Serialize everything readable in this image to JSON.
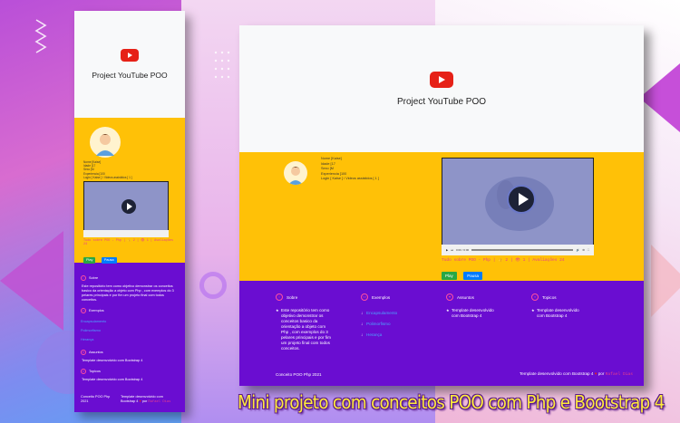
{
  "colors": {
    "primary_purple": "#6a0dd1",
    "yellow": "#ffc107",
    "light": "#f8f9fa",
    "youtube_red": "#e62117",
    "pink_text": "#e83e8c",
    "caption_yellow": "#ffeb3b",
    "play_button": "#28a745",
    "pause_button": "#007bff",
    "link_blue": "#4da3ff"
  },
  "app": {
    "title": "Project YouTube POO",
    "logo_icon": "youtube-play-icon"
  },
  "profile": {
    "nome": "Nome [Kaise]",
    "idade": "Idade [17",
    "sexo": "Sexo [M",
    "experiencia": "Experiencia [100",
    "login_line": "Login [ Kaise ] / Videos assistidos [ 1 ]"
  },
  "video": {
    "time": "0:00 / 0:00",
    "stats": "Tudo sobre POO - Php | 👍 2 | 👁 1 | Avaliações 24",
    "play_label": "Play",
    "pause_label": "Pausa"
  },
  "sections": {
    "sobre": {
      "heading": "Sobre",
      "text": "Este repositório tem como objetivo demonstrar os conceitos basico da orientação a objeto com Php , com exemplos do 3 pelares principais e por fim um projeto final com todos conceitos."
    },
    "exemplos": {
      "heading": "Exemplos",
      "links": [
        "Encapsulamento",
        "Polimorfismo",
        "Herança"
      ]
    },
    "assuntos": {
      "heading": "Assuntos",
      "text": "Template desenvolvido com Bootstrap 4"
    },
    "topicos": {
      "heading": "Topicos",
      "text": "Template desenvolvido com Bootstrap 4"
    }
  },
  "footer": {
    "left": "Conceito POO Php 2021",
    "right_prefix": "Template desenvolvido com Bootstrap 4",
    "right_por": "por",
    "author": "Rafael Dias"
  },
  "caption": "Mini projeto com conceitos POO com Php e Bootstrap 4"
}
